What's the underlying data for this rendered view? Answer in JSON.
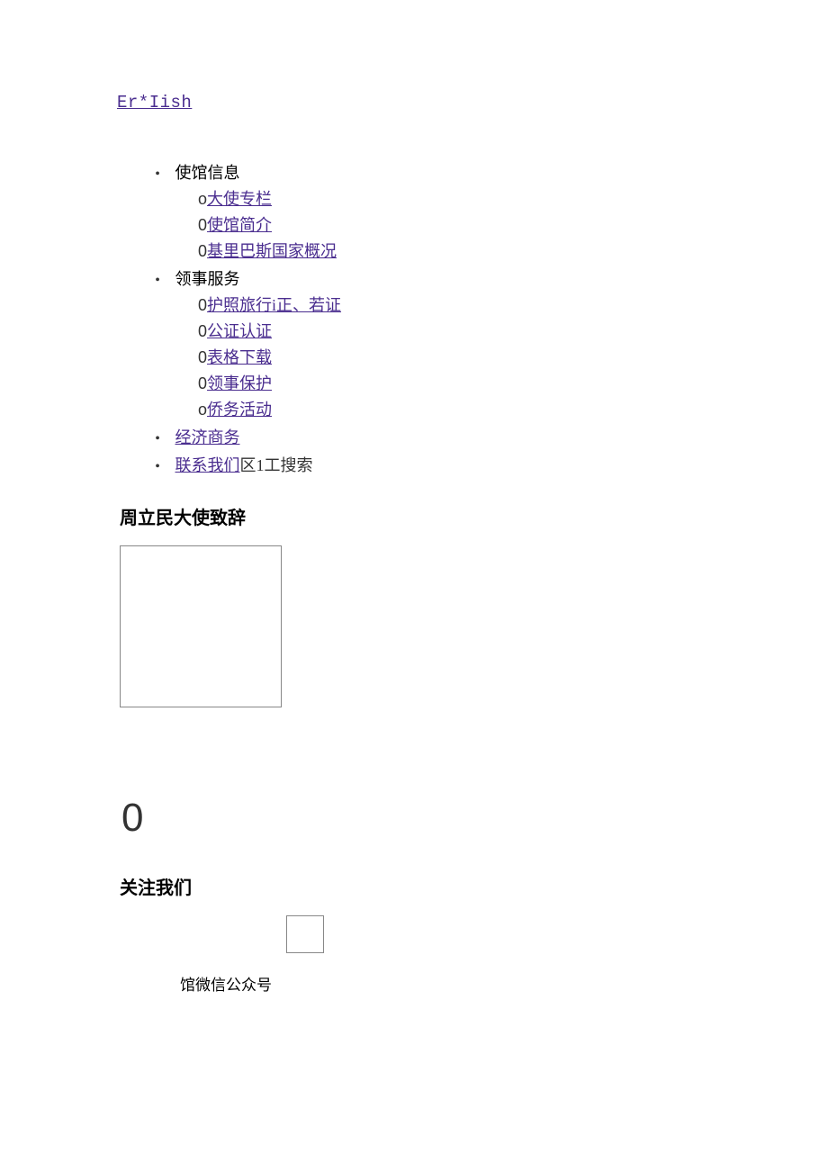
{
  "top_link": "Er*Iish",
  "nav": [
    {
      "label": "使馆信息",
      "children": [
        {
          "marker": "o",
          "label": "大使专栏",
          "link": true
        },
        {
          "marker": "0",
          "label": "使馆简介",
          "link": true
        },
        {
          "marker": "0",
          "label": "基里巴斯国家概况",
          "link": true
        }
      ]
    },
    {
      "label": "领事服务",
      "children": [
        {
          "marker": "0",
          "label": "护照旅行i正、若证",
          "link": true
        },
        {
          "marker": "0",
          "label": "公证认证",
          "link": true
        },
        {
          "marker": "0",
          "label": "表格下载",
          "link": true
        },
        {
          "marker": "0",
          "label": "领事保护",
          "link": true
        },
        {
          "marker": "o",
          "label": "侨务活动",
          "link": true
        }
      ]
    },
    {
      "label": "经济商务",
      "link": true
    },
    {
      "label": "联系我们",
      "link": true,
      "extra": "区1工搜索"
    }
  ],
  "section1_title": "周立民大使致辞",
  "big_zero": "0",
  "section2_title": "关注我们",
  "qr_caption": "馆微信公众号"
}
